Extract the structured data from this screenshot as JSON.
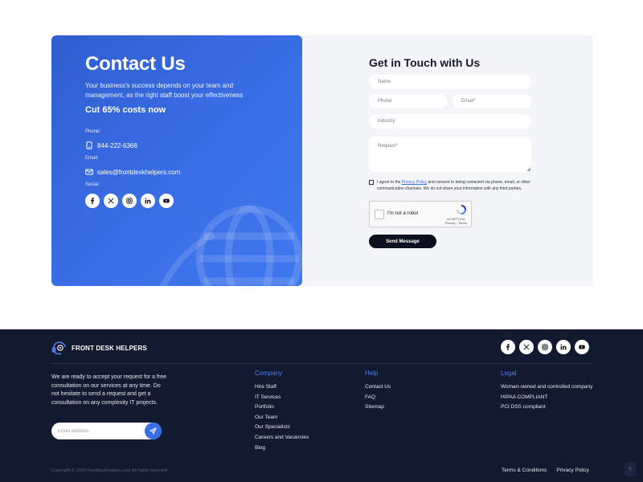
{
  "contact": {
    "title": "Contact Us",
    "description": "Your business's success depends on your team and management, as the right staff boost your effectiveness",
    "cut_text": "Cut 65% costs now",
    "phone_label": "Phone:",
    "phone": "844-222-6368",
    "email_label": "Email:",
    "email": "sales@frontdeskhelpers.com",
    "social_label": "Social:"
  },
  "form": {
    "title": "Get in Touch with Us",
    "name_placeholder": "Name",
    "phone_placeholder": "Phone",
    "email_placeholder": "Email*",
    "industry_placeholder": "Industry",
    "request_placeholder": "Request*",
    "consent_before": "I agree to the ",
    "consent_link": "Privacy Policy",
    "consent_after": " and consent to being contacted via phone, email, or other communication channels. We do not share your information with any third parties.",
    "captcha_text": "I'm not a robot",
    "captcha_brand": "reCAPTCHA",
    "captcha_terms": "Privacy - Terms",
    "send_label": "Send Message"
  },
  "footer": {
    "brand": "FRONT DESK HELPERS",
    "about": "We are ready to accept your request for a free consultation on our services at any time. Do not hesitate to send a request and get a consultation on any complexity IT projects.",
    "email_placeholder": "Email address",
    "columns": [
      {
        "title": "Company",
        "links": [
          "Hire Staff",
          "IT Services",
          "Portfolio",
          "Our Team",
          "Our Specialists",
          "Careers and Vacancies",
          "Blog"
        ]
      },
      {
        "title": "Help",
        "links": [
          "Contact Us",
          "FAQ",
          "Sitemap"
        ]
      },
      {
        "title": "Legal",
        "links": [
          "Woman-owned and controlled company",
          "HIPAA COMPLIANT",
          "PCI DSS compliant"
        ]
      }
    ],
    "copyright": "Copyright © 2024 Frontdeskhelpers.com All rights reserved.",
    "bottom_links": [
      "Terms & Conditions",
      "Privacy Policy"
    ]
  },
  "social_icons": [
    "facebook-icon",
    "x-icon",
    "instagram-icon",
    "linkedin-icon",
    "youtube-icon"
  ],
  "colors": {
    "accent": "#3a6ee6",
    "dark": "#121a2f",
    "button": "#0b0f1e"
  }
}
